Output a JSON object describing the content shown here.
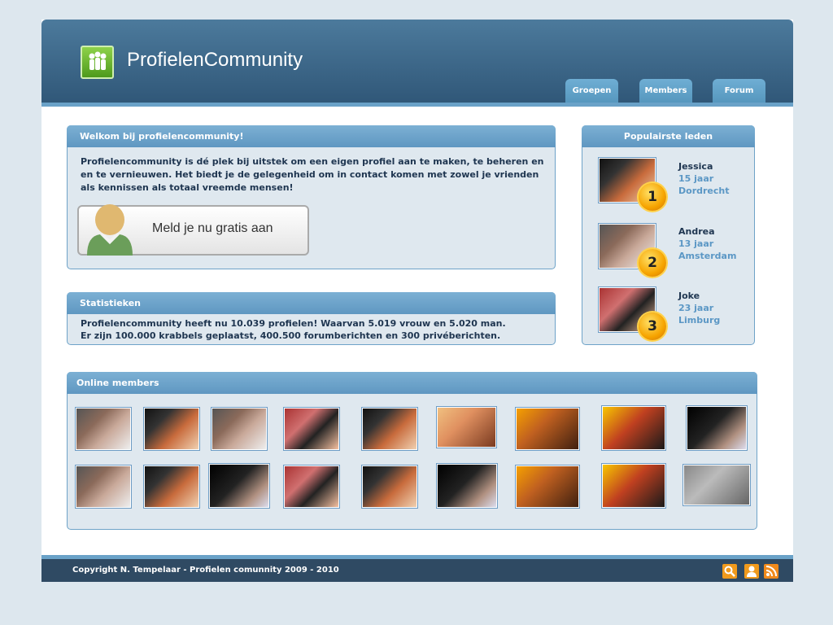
{
  "header": {
    "title": "ProfielenCommunity",
    "logo_icon": "people-icon",
    "tabs": [
      "Groepen",
      "Members",
      "Forum"
    ]
  },
  "welcome": {
    "heading": "Welkom bij profielencommunity!",
    "lines": [
      "Profielencommunity is dé plek bij uitstek om een eigen profiel aan te maken, te beheren en",
      "en te vernieuwen. Het biedt je de gelegenheid om in contact komen met zowel je vrienden",
      "als kennissen als totaal vreemde mensen!"
    ],
    "signup_label": "Meld je nu gratis aan"
  },
  "stats": {
    "heading": "Statistieken",
    "lines": [
      "Profielencommunity heeft nu 10.039 profielen! Waarvan 5.019 vrouw en 5.020 man.",
      "Er zijn 100.000 krabbels geplaatst, 400.500 forumberichten en 300 privéberichten."
    ]
  },
  "popular": {
    "heading": "Populairste leden",
    "members": [
      {
        "rank": "1",
        "name": "Jessica",
        "age": "15 jaar",
        "city": "Dordrecht"
      },
      {
        "rank": "2",
        "name": "Andrea",
        "age": "13 jaar",
        "city": "Amsterdam"
      },
      {
        "rank": "3",
        "name": "Joke",
        "age": "23 jaar",
        "city": "Limburg"
      }
    ]
  },
  "online": {
    "heading": "Online members"
  },
  "footer": {
    "copyright": "Copyright N. Tempelaar - Profielen comunnity 2009 - 2010",
    "icons": [
      "search-icon",
      "user-icon",
      "rss-icon"
    ]
  },
  "colors": {
    "header": "#2f5677",
    "accent": "#6aa2c8",
    "panel": "#dfe8ef",
    "text": "#1e3550",
    "muted": "#5b97c5",
    "footer": "#2f4a63"
  }
}
